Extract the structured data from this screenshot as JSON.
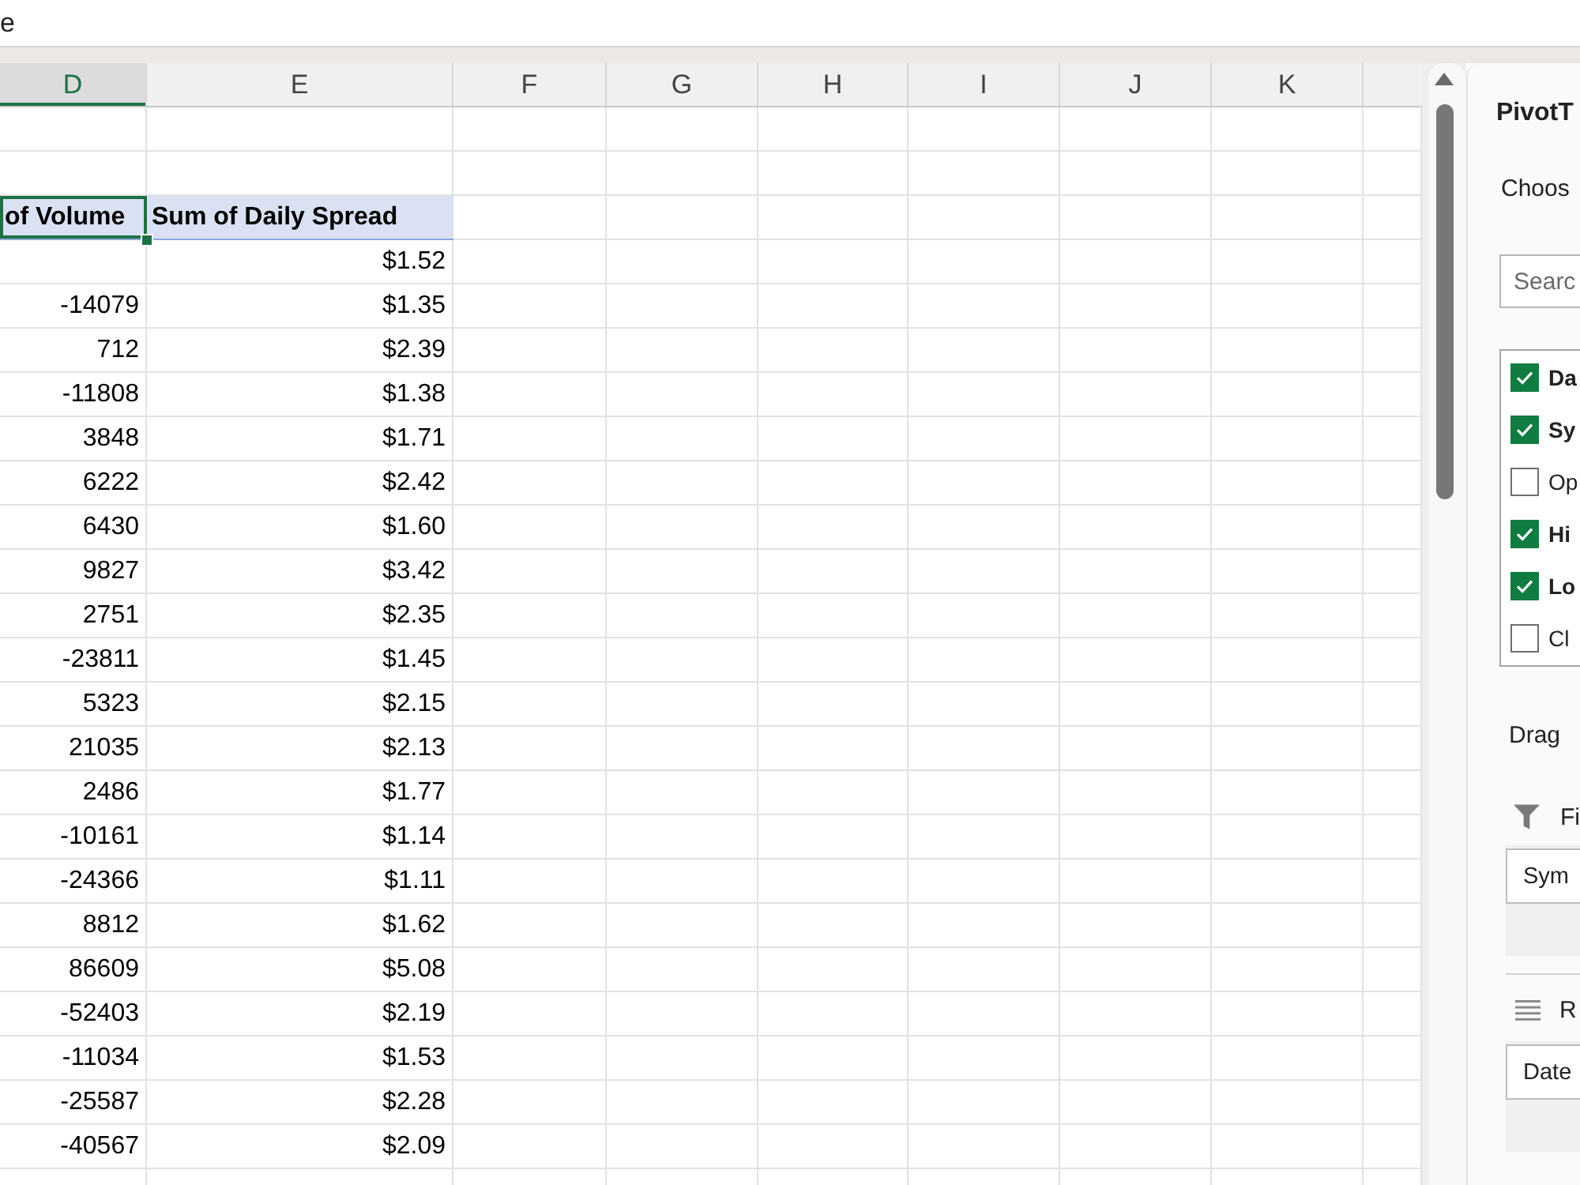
{
  "top_bar": {
    "text": "e"
  },
  "columns": [
    {
      "label": "D",
      "selected": true
    },
    {
      "label": "E",
      "selected": false
    },
    {
      "label": "F",
      "selected": false
    },
    {
      "label": "G",
      "selected": false
    },
    {
      "label": "H",
      "selected": false
    },
    {
      "label": "I",
      "selected": false
    },
    {
      "label": "J",
      "selected": false
    },
    {
      "label": "K",
      "selected": false
    }
  ],
  "pivot_table": {
    "headers": [
      {
        "label": "of Volume",
        "selected": true
      },
      {
        "label": "Sum of Daily Spread",
        "selected": false
      }
    ],
    "rows": [
      {
        "daily_spread": "$1.52"
      },
      {
        "volume": "-14079",
        "daily_spread": "$1.35"
      },
      {
        "volume": "712",
        "daily_spread": "$2.39"
      },
      {
        "volume": "-11808",
        "daily_spread": "$1.38"
      },
      {
        "volume": "3848",
        "daily_spread": "$1.71"
      },
      {
        "volume": "6222",
        "daily_spread": "$2.42"
      },
      {
        "volume": "6430",
        "daily_spread": "$1.60"
      },
      {
        "volume": "9827",
        "daily_spread": "$3.42"
      },
      {
        "volume": "2751",
        "daily_spread": "$2.35"
      },
      {
        "volume": "-23811",
        "daily_spread": "$1.45"
      },
      {
        "volume": "5323",
        "daily_spread": "$2.15"
      },
      {
        "volume": "21035",
        "daily_spread": "$2.13"
      },
      {
        "volume": "2486",
        "daily_spread": "$1.77"
      },
      {
        "volume": "-10161",
        "daily_spread": "$1.14"
      },
      {
        "volume": "-24366",
        "daily_spread": "$1.11"
      },
      {
        "volume": "8812",
        "daily_spread": "$1.62"
      },
      {
        "volume": "86609",
        "daily_spread": "$5.08"
      },
      {
        "volume": "-52403",
        "daily_spread": "$2.19"
      },
      {
        "volume": "-11034",
        "daily_spread": "$1.53"
      },
      {
        "volume": "-25587",
        "daily_spread": "$2.28"
      },
      {
        "volume": "-40567",
        "daily_spread": "$2.09"
      }
    ]
  },
  "pivot_panel": {
    "title": "PivotT",
    "choose_label": "Choos",
    "search": {
      "placeholder": "Searc"
    },
    "fields": [
      {
        "label": "Da",
        "checked": true
      },
      {
        "label": "Sy",
        "checked": true
      },
      {
        "label": "Op",
        "checked": false
      },
      {
        "label": "Hi",
        "checked": true
      },
      {
        "label": "Lo",
        "checked": true
      },
      {
        "label": "Cl",
        "checked": false
      }
    ],
    "drag_label": "Drag",
    "areas": [
      {
        "kind": "filters",
        "title": "Fi",
        "items": [
          "Sym"
        ]
      },
      {
        "kind": "rows",
        "title": "R",
        "items": [
          "Date"
        ]
      }
    ]
  }
}
